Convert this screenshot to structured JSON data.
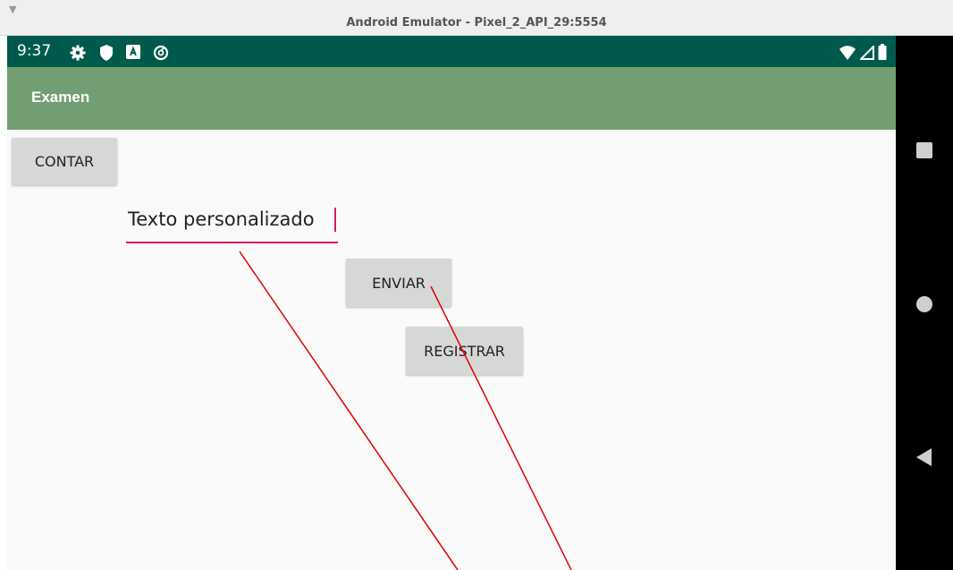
{
  "window": {
    "title": "Android Emulator - Pixel_2_API_29:5554",
    "collapse_icon": "triangle-down-icon"
  },
  "statusbar": {
    "time": "9:37",
    "icons": [
      "settings-gear-icon",
      "shield-icon",
      "keyboard-a-icon",
      "data-saver-icon"
    ],
    "right_icons": [
      "wifi-icon",
      "cell-signal-icon",
      "battery-icon"
    ]
  },
  "appbar": {
    "title": "Examen",
    "color": "#739e73",
    "status_color": "#005a4c"
  },
  "buttons": {
    "contar": "CONTAR",
    "enviar": "ENVIAR",
    "registrar": "REGISTRAR"
  },
  "edittext": {
    "value": "Texto personalizado",
    "accent": "#d81b60"
  },
  "navbar": {
    "icons": [
      "recents-square-icon",
      "home-circle-icon",
      "back-triangle-icon"
    ]
  },
  "annotation": {
    "color": "#e00000"
  }
}
